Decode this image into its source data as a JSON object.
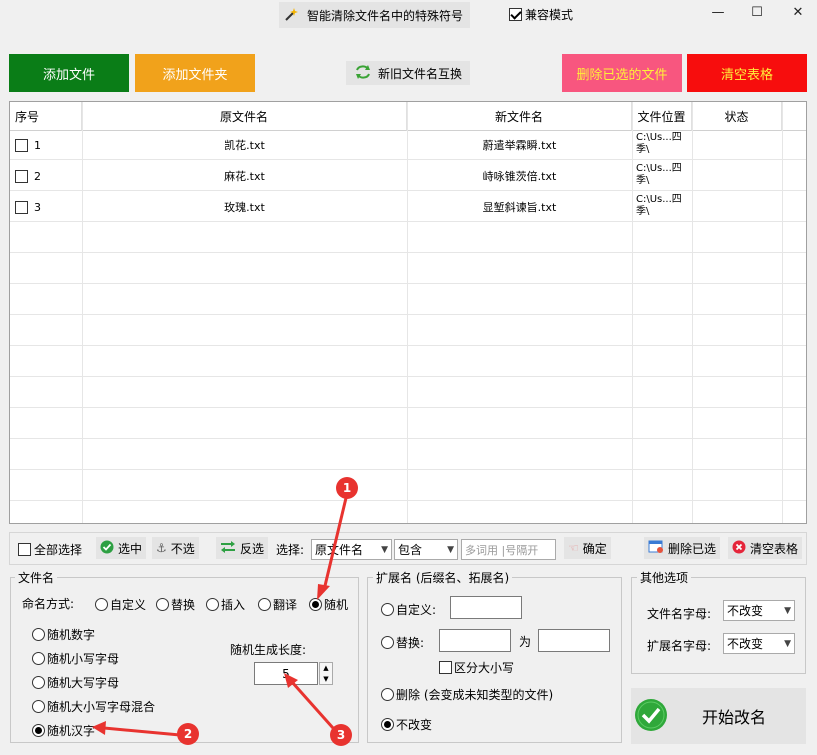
{
  "window": {
    "title": "智能清除文件名中的特殊符号",
    "compat_label": "兼容模式",
    "minimize": "—",
    "maximize": "☐",
    "close": "✕"
  },
  "toolbar": {
    "add_file": "添加文件",
    "add_folder": "添加文件夹",
    "swap_names": "新旧文件名互换",
    "delete_selected": "删除已选的文件",
    "clear_table": "清空表格"
  },
  "colors": {
    "add_file": "#0a7d17",
    "add_folder": "#f1a21b",
    "delete_selected": "#f8567f",
    "clear_table": "#f70d0d",
    "marker": "#e8332f"
  },
  "table": {
    "headers": [
      "序号",
      "原文件名",
      "新文件名",
      "文件位置",
      "状态"
    ],
    "rows": [
      {
        "index": "1",
        "original": "凯花.txt",
        "new": "蔚遣举霖瞬.txt",
        "location": "C:\\Us...四季\\",
        "status": ""
      },
      {
        "index": "2",
        "original": "麻花.txt",
        "new": "峙咏锥茨倍.txt",
        "location": "C:\\Us...四季\\",
        "status": ""
      },
      {
        "index": "3",
        "original": "玫瑰.txt",
        "new": "显堑斜谏旨.txt",
        "location": "C:\\Us...四季\\",
        "status": ""
      }
    ]
  },
  "selection_bar": {
    "select_all": "全部选择",
    "select": "选中",
    "deselect": "不选",
    "invert": "反选",
    "choose_label": "选择:",
    "field_select": "原文件名",
    "match_select": "包含",
    "keyword_placeholder": "多词用 |号隔开",
    "confirm": "确定",
    "delete_selected": "删除已选",
    "clear_table": "清空表格"
  },
  "filename_group": {
    "title": "文件名",
    "mode_label": "命名方式:",
    "modes": [
      "自定义",
      "替换",
      "插入",
      "翻译",
      "随机"
    ],
    "selected_mode": "随机",
    "random_options": [
      "随机数字",
      "随机小写字母",
      "随机大写字母",
      "随机大小写字母混合",
      "随机汉字"
    ],
    "selected_random": "随机汉字",
    "length_label": "随机生成长度:",
    "length_value": "5"
  },
  "extension_group": {
    "title": "扩展名 (后缀名、拓展名)",
    "custom_label": "自定义:",
    "replace_label": "替换:",
    "to_label": "为",
    "case_label": "区分大小写",
    "delete_label": "删除 (会变成未知类型的文件)",
    "unchanged_label": "不改变"
  },
  "other_group": {
    "title": "其他选项",
    "filename_case_label": "文件名字母:",
    "filename_case_value": "不改变",
    "ext_case_label": "扩展名字母:",
    "ext_case_value": "不改变"
  },
  "start_button": "开始改名",
  "annotations": [
    "1",
    "2",
    "3"
  ]
}
